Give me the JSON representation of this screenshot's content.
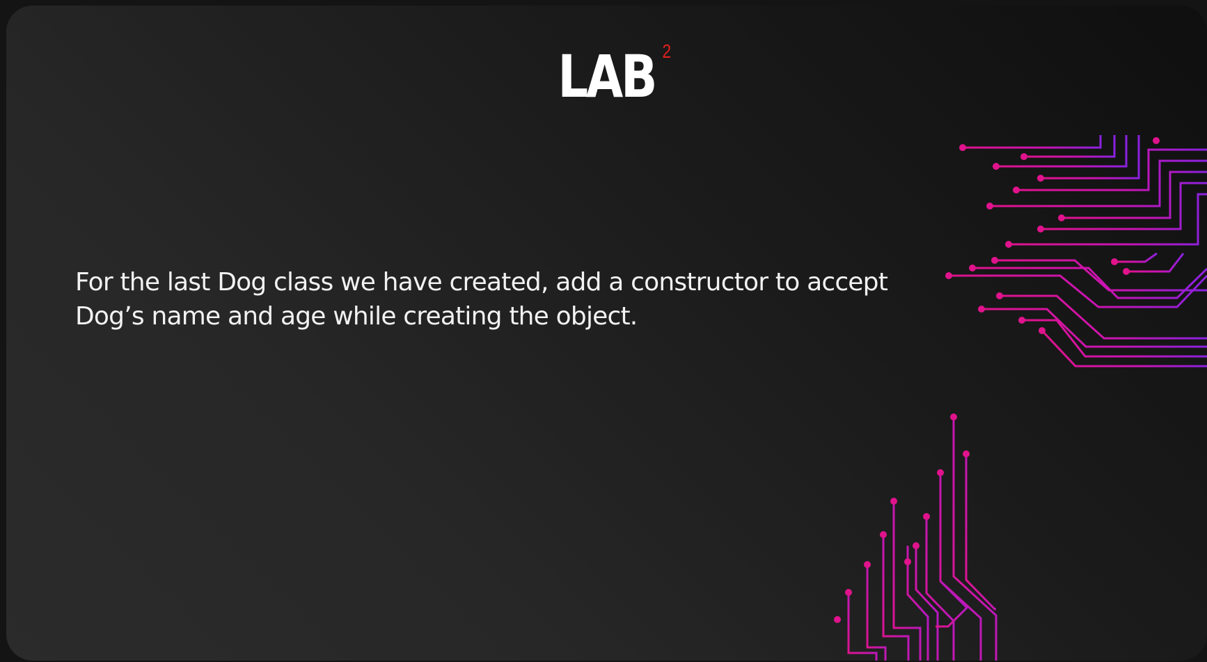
{
  "slide": {
    "title": "LAB",
    "title_superscript": "2",
    "body": "For the last Dog class we have created, add a constructor to accept Dog’s name and age while creating the object."
  },
  "colors": {
    "background": "#262626",
    "title": "#ffffff",
    "superscript": "#e0201d",
    "body_text": "#f2f2f2",
    "circuit_pink": "#e0138c",
    "circuit_purple": "#8a22e0"
  },
  "decorations": [
    "circuit-lines-right",
    "circuit-lines-bottom"
  ]
}
